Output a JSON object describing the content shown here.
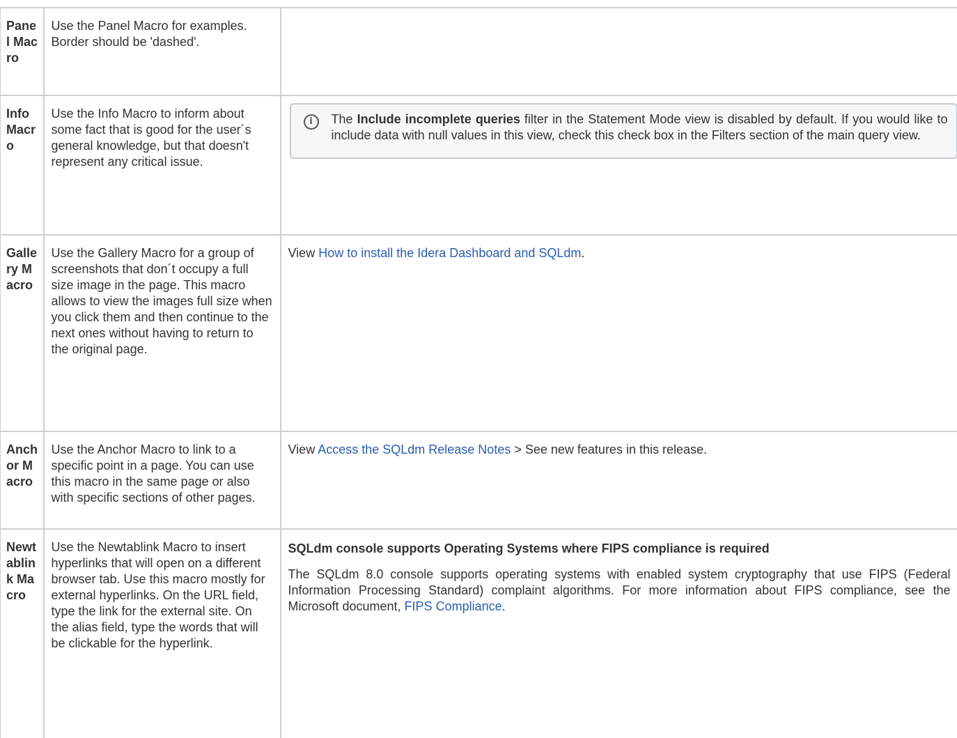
{
  "rows": [
    {
      "name": "Panel Macro",
      "description": "Use the Panel Macro for examples. Border should be 'dashed'."
    },
    {
      "name": "Info Macro",
      "description": "Use the Info Macro to inform about some fact that is good for the user´s general knowledge, but that doesn't represent any critical issue.",
      "example": {
        "icon": "info-circle-icon",
        "text_before": "The ",
        "text_bold": "Include incomplete queries",
        "text_after": " filter in the Statement Mode view is disabled by default.  If you would like to include data with null values in this view, check this check box in the Filters section of the main query view."
      }
    },
    {
      "name": "Gallery Macro",
      "description": "Use the Gallery Macro for a group of screenshots that don´t occupy a full size image in the page. This macro allows to view the images full size when you click them and then continue to the next ones without having to return to the original page.",
      "example": {
        "prefix": "View ",
        "link": "How to install the Idera Dashboard and SQLdm",
        "suffix": "."
      }
    },
    {
      "name": "Anchor Macro",
      "description": "Use the Anchor Macro to link to a specific point in a page. You can use this macro in the same page or also with specific sections of other pages.",
      "example": {
        "prefix": "View ",
        "link": "Access the SQLdm Release Notes",
        "suffix": " > See new features in this release."
      }
    },
    {
      "name": "Newtablink Macro",
      "description": "Use the Newtablink Macro to insert hyperlinks that will open on a different browser tab. Use this macro mostly for external hyperlinks. On the URL field, type the link for the external site. On the alias field, type the words that will be clickable for the hyperlink.",
      "example": {
        "title": "SQLdm console supports Operating Systems where FIPS compliance is required",
        "body": "The SQLdm 8.0 console supports operating systems with enabled system cryptography that use FIPS (Federal Information Processing Standard) complaint algorithms. For more information about FIPS compliance, see the Microsoft document,  ",
        "link": "FIPS Compliance",
        "suffix": "."
      }
    }
  ],
  "colors": {
    "link": "#2a5db0",
    "border": "#cfcfcf",
    "info_box_border": "#c3cbd5",
    "info_box_bg": "#f6f7f9"
  }
}
